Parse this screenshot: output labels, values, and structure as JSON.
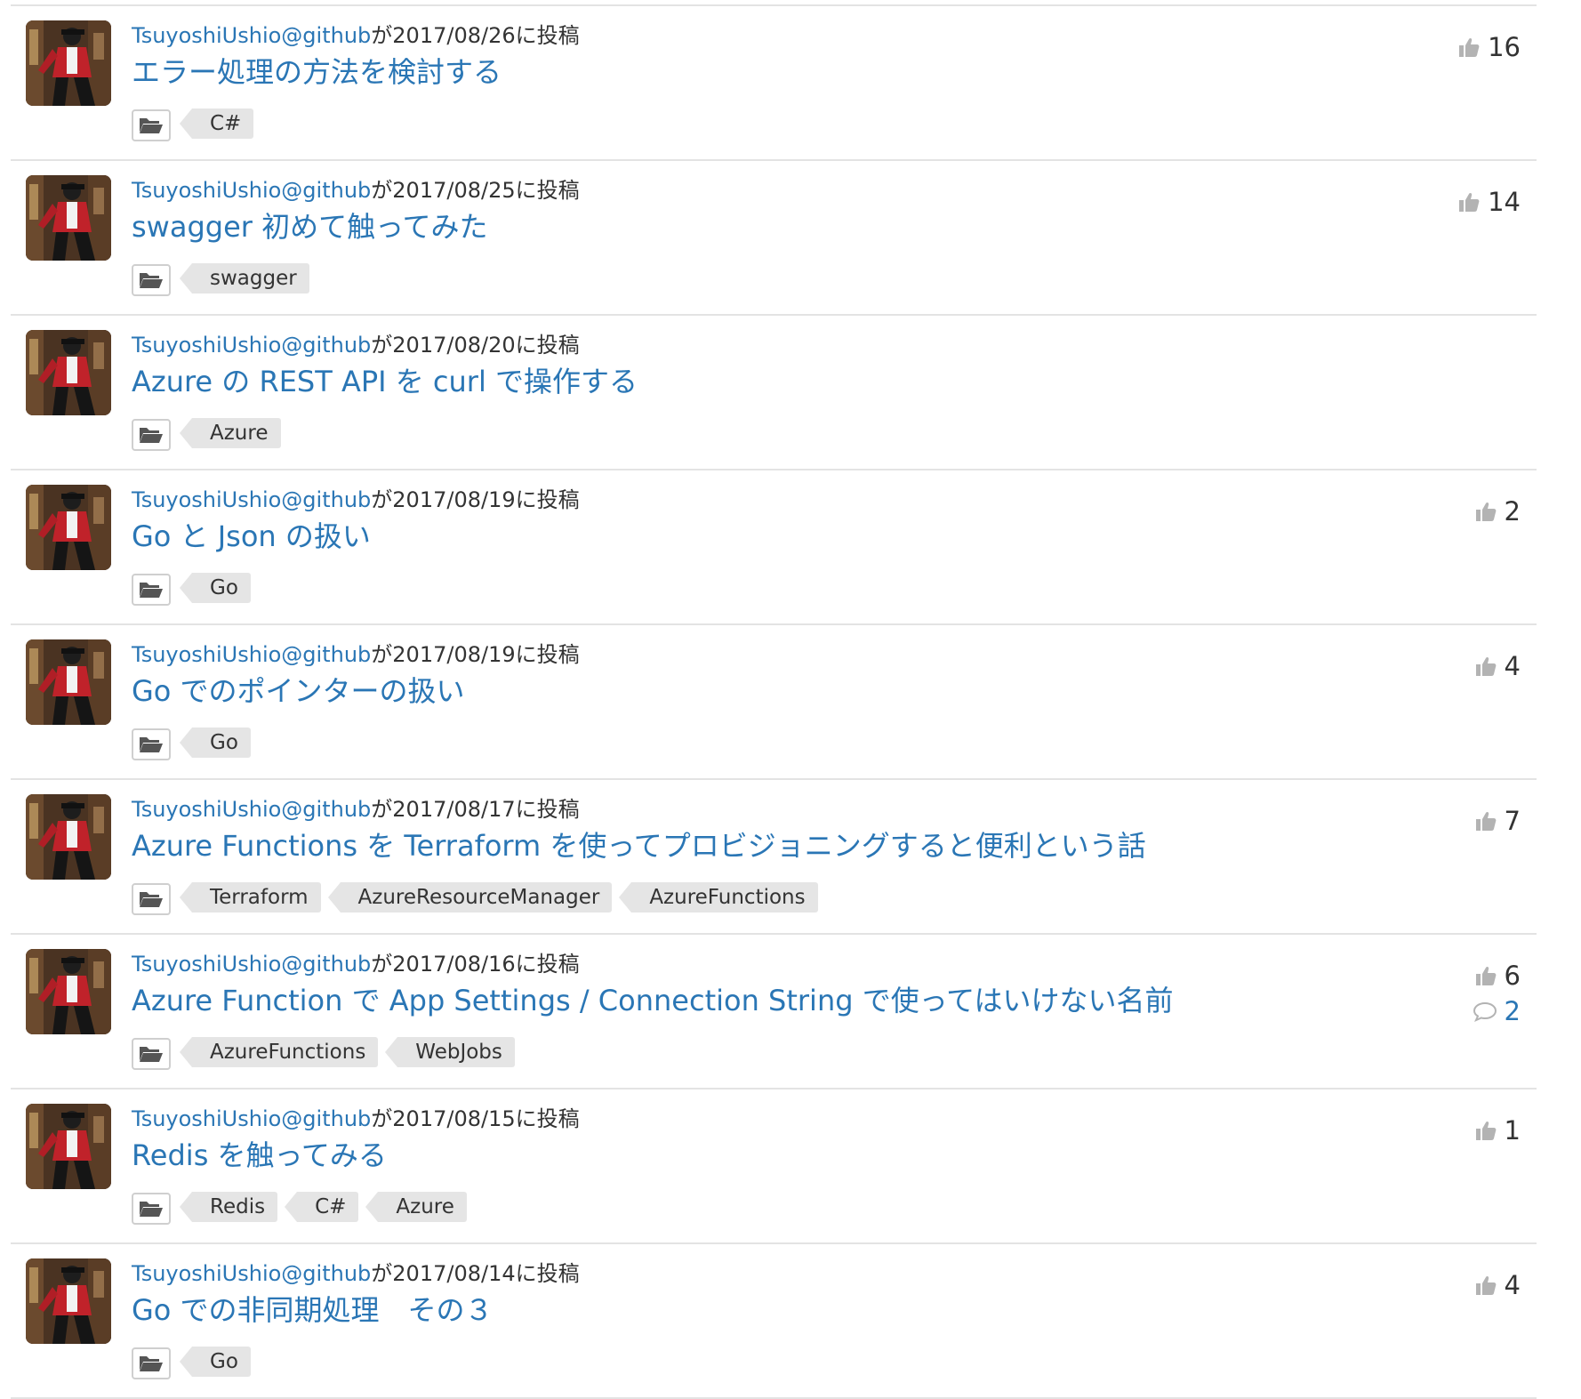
{
  "posts": [
    {
      "author": "TsuyoshiUshio@github",
      "posted": "が2017/08/26に投稿",
      "title": "エラー処理の方法を検討する",
      "tags": [
        "C#"
      ],
      "likes": "16",
      "comments": ""
    },
    {
      "author": "TsuyoshiUshio@github",
      "posted": "が2017/08/25に投稿",
      "title": "swagger 初めて触ってみた",
      "tags": [
        "swagger"
      ],
      "likes": "14",
      "comments": ""
    },
    {
      "author": "TsuyoshiUshio@github",
      "posted": "が2017/08/20に投稿",
      "title": "Azure の REST API を curl で操作する",
      "tags": [
        "Azure"
      ],
      "likes": "",
      "comments": ""
    },
    {
      "author": "TsuyoshiUshio@github",
      "posted": "が2017/08/19に投稿",
      "title": "Go と Json の扱い",
      "tags": [
        "Go"
      ],
      "likes": "2",
      "comments": ""
    },
    {
      "author": "TsuyoshiUshio@github",
      "posted": "が2017/08/19に投稿",
      "title": "Go でのポインターの扱い",
      "tags": [
        "Go"
      ],
      "likes": "4",
      "comments": ""
    },
    {
      "author": "TsuyoshiUshio@github",
      "posted": "が2017/08/17に投稿",
      "title": "Azure Functions を Terraform を使ってプロビジョニングすると便利という話",
      "tags": [
        "Terraform",
        "AzureResourceManager",
        "AzureFunctions"
      ],
      "likes": "7",
      "comments": ""
    },
    {
      "author": "TsuyoshiUshio@github",
      "posted": "が2017/08/16に投稿",
      "title": "Azure Function で App Settings / Connection String で使ってはいけない名前",
      "tags": [
        "AzureFunctions",
        "WebJobs"
      ],
      "likes": "6",
      "comments": "2"
    },
    {
      "author": "TsuyoshiUshio@github",
      "posted": "が2017/08/15に投稿",
      "title": "Redis を触ってみる",
      "tags": [
        "Redis",
        "C#",
        "Azure"
      ],
      "likes": "1",
      "comments": ""
    },
    {
      "author": "TsuyoshiUshio@github",
      "posted": "が2017/08/14に投稿",
      "title": "Go での非同期処理　その３",
      "tags": [
        "Go"
      ],
      "likes": "4",
      "comments": ""
    }
  ],
  "icons": {
    "folder": "folder-open-icon",
    "like": "thumbs-up-icon",
    "comment": "comment-icon",
    "avatar": "user-avatar"
  },
  "colors": {
    "link": "#2a76b5",
    "text": "#333333",
    "tag_bg": "#e5e5e5",
    "divider": "#e3e3e3",
    "icon_gray": "#b3b3b3"
  }
}
